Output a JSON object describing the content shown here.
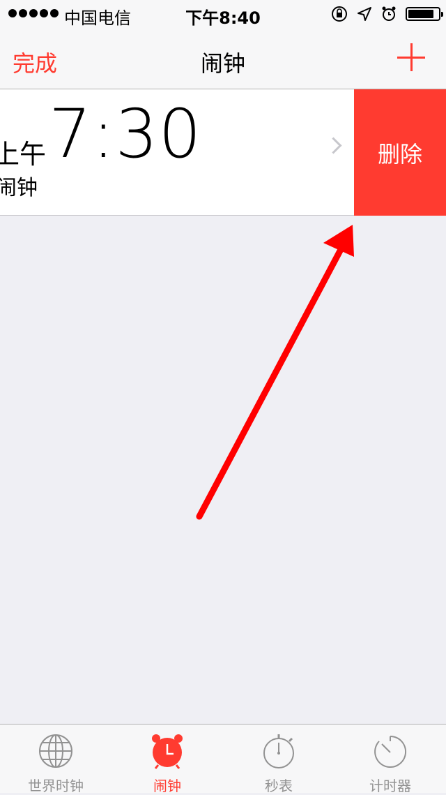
{
  "status_bar": {
    "carrier": "中国电信",
    "time": "下午8:40",
    "icons": [
      "signal-dots-icon",
      "rotation-lock-icon",
      "location-arrow-icon",
      "alarm-clock-icon",
      "battery-icon"
    ],
    "battery_level": 0.85
  },
  "nav": {
    "done_label": "完成",
    "title": "闹钟",
    "add_icon": "plus-icon"
  },
  "alarm": {
    "ampm": "上午",
    "time": "7:30",
    "label": "闹钟",
    "delete_label": "删除"
  },
  "tabs": [
    {
      "label": "世界时钟",
      "icon": "globe-icon",
      "active": false
    },
    {
      "label": "闹钟",
      "icon": "alarm-clock-icon",
      "active": true
    },
    {
      "label": "秒表",
      "icon": "stopwatch-icon",
      "active": false
    },
    {
      "label": "计时器",
      "icon": "timer-icon",
      "active": false
    }
  ],
  "colors": {
    "accent": "#ff3b30",
    "background": "#efeff4",
    "bar_background": "#f7f7f8",
    "inactive_tab": "#929292",
    "annotation": "#ff0000"
  }
}
